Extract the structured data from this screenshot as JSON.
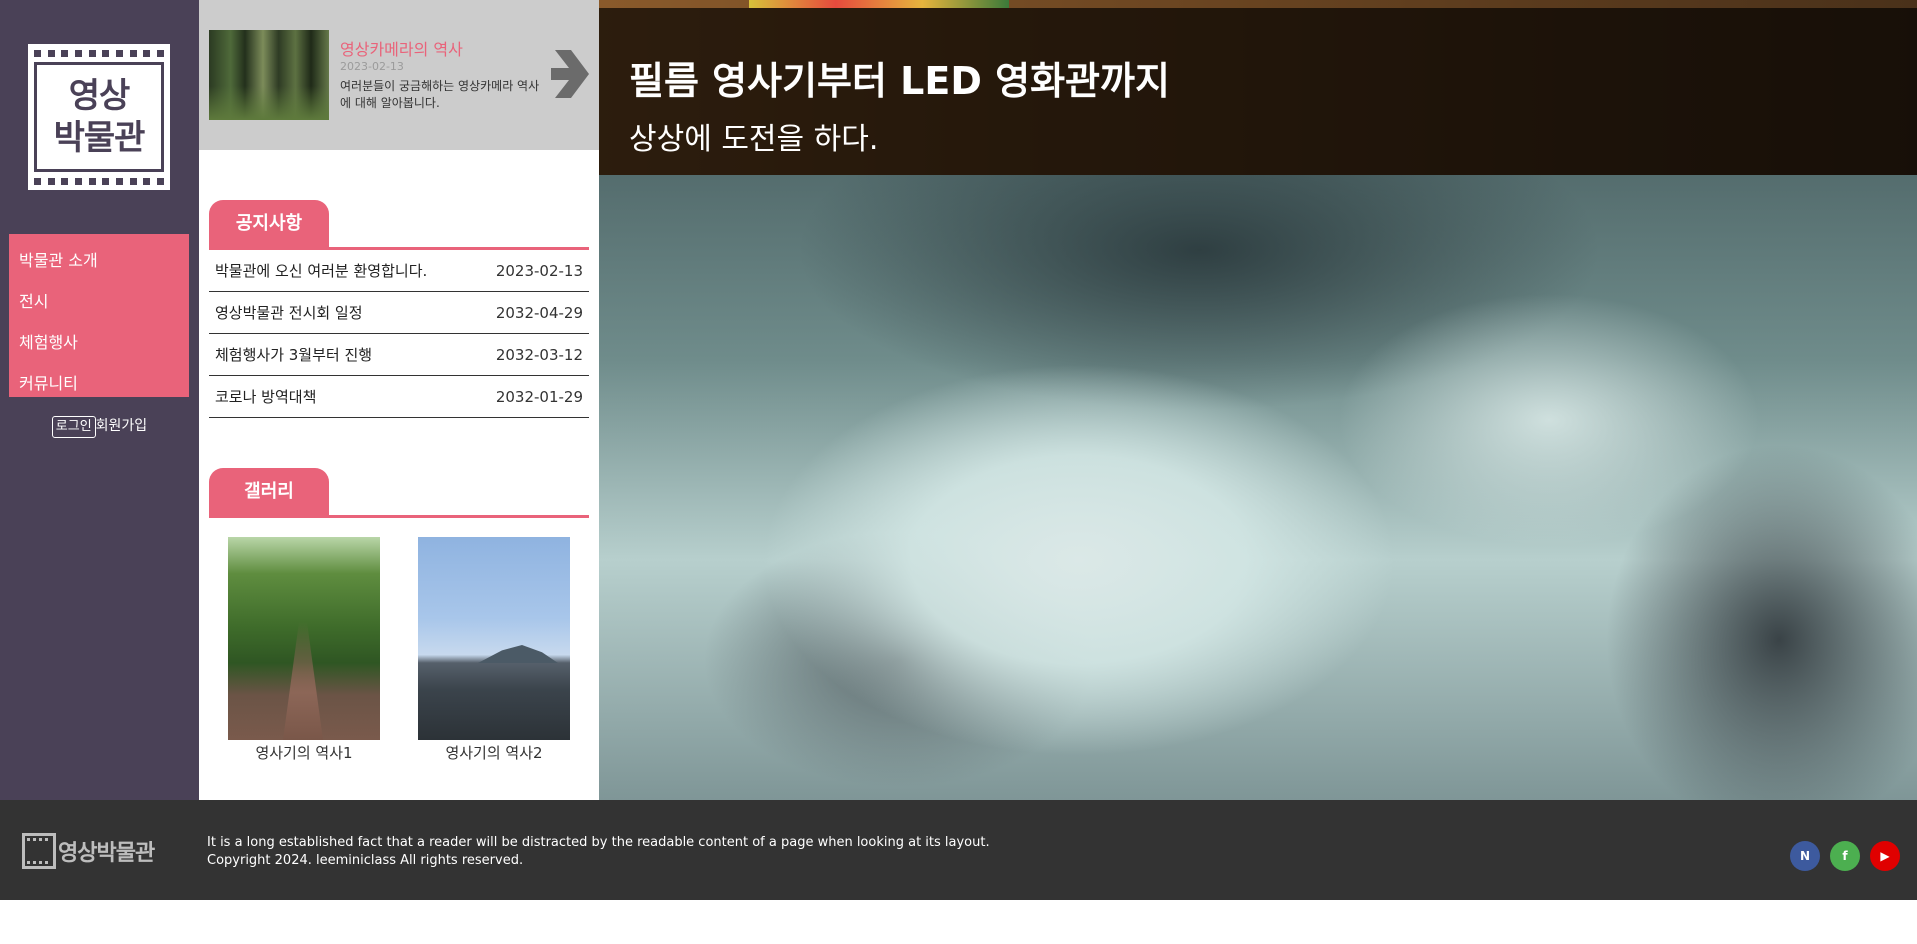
{
  "sidebar": {
    "logo_text": "영상\n박물관",
    "menu": [
      {
        "label": "박물관 소개"
      },
      {
        "label": "전시"
      },
      {
        "label": "체험행사"
      },
      {
        "label": "커뮤니티"
      }
    ],
    "login_label": "로그인",
    "join_label": "회원가입"
  },
  "banner": {
    "title": "영상카메라의 역사",
    "date": "2023-02-13",
    "description": "여러분들이 궁금해하는 영상카메라 역사에 대해 알아봅니다."
  },
  "notice": {
    "tab_label": "공지사항",
    "items": [
      {
        "title": "박물관에 오신 여러분 환영합니다.",
        "date": "2023-02-13"
      },
      {
        "title": "영상박물관 전시회 일정",
        "date": "2032-04-29"
      },
      {
        "title": "체험행사가 3월부터 진행",
        "date": "2032-03-12"
      },
      {
        "title": "코로나 방역대책",
        "date": "2032-01-29"
      }
    ]
  },
  "gallery": {
    "tab_label": "갤러리",
    "items": [
      {
        "caption": "영사기의 역사1"
      },
      {
        "caption": "영사기의 역사2"
      }
    ]
  },
  "hero": {
    "title": "필름 영사기부터 LED 영화관까지",
    "subtitle": "상상에 도전을 하다."
  },
  "footer": {
    "logo_text": "영상박물관",
    "line1": "It is a long established fact that a reader will be distracted by the readable content of a page when looking at its layout.",
    "line2": "Copyright 2024. leeminiclass All rights reserved.",
    "sns": [
      {
        "icon": "naver-icon",
        "label": "N",
        "color": "#3d5a9e"
      },
      {
        "icon": "facebook-icon",
        "label": "f",
        "color": "#4caf50"
      },
      {
        "icon": "youtube-icon",
        "label": "▶",
        "color": "#e00000"
      }
    ]
  },
  "colors": {
    "accent": "#e9637a",
    "sidebar_bg": "#4a4157",
    "footer_bg": "#333333"
  }
}
